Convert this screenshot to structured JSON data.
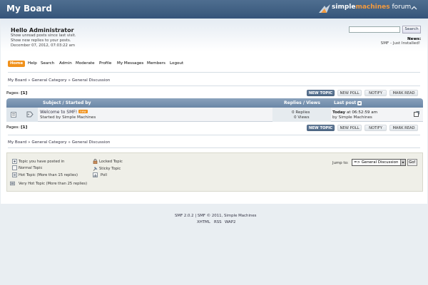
{
  "header": {
    "forum_name": "My Board",
    "logo_simple": "simple",
    "logo_machines": "machines",
    "logo_forum": " forum"
  },
  "user": {
    "greeting": "Hello Administrator",
    "unread_posts": "Show unread posts since last visit.",
    "new_replies": "Show new replies to your posts.",
    "datetime": "December 07, 2012, 07:03:22 am"
  },
  "search": {
    "button_label": "Search",
    "value": ""
  },
  "news": {
    "label": "News:",
    "text": "SMF - Just Installed!"
  },
  "menu": {
    "home": "Home",
    "help": "Help",
    "search": "Search",
    "admin": "Admin",
    "moderate": "Moderate",
    "profile": "Profile",
    "messages": "My Messages",
    "members": "Members",
    "logout": "Logout"
  },
  "breadcrumb": {
    "board": "My Board",
    "category": "General Category",
    "forum": "General Discussion",
    "sep": "»"
  },
  "pages": {
    "label": "Pages:",
    "current": "[1]"
  },
  "buttons": {
    "new_topic": "NEW TOPIC",
    "new_poll": "NEW POLL",
    "notify": "NOTIFY",
    "mark_read": "MARK READ"
  },
  "table": {
    "col_subject": "Subject / Started by",
    "col_replies": "Replies / Views",
    "col_lastpost": "Last post",
    "rows": [
      {
        "subject": "Welcome to SMF!",
        "new_badge": "new",
        "started_by": "Started by Simple Machines",
        "replies": "0 Replies",
        "views": "0 Views",
        "last_day": "Today",
        "last_time": " at 06:52:59 am",
        "last_by": "by Simple Machines"
      }
    ]
  },
  "legend": {
    "posted": "Topic you have posted in",
    "normal": "Normal Topic",
    "hot": "Hot Topic (More than 15 replies)",
    "very_hot": "Very Hot Topic (More than 25 replies)",
    "locked": "Locked Topic",
    "sticky": "Sticky Topic",
    "poll": "Poll"
  },
  "jump": {
    "label": "Jump to:",
    "selected": "=> General Discussion",
    "go": "Go!"
  },
  "footer": {
    "credits": "SMF 2.0.2 | SMF © 2011, Simple Machines",
    "xhtml": "XHTML",
    "rss": "RSS",
    "wap2": "WAP2"
  },
  "colors": {
    "header": "#3d5d80",
    "menu_active": "#f0911b",
    "table_head": "#7a94b2",
    "button_primary": "#5a7392"
  }
}
